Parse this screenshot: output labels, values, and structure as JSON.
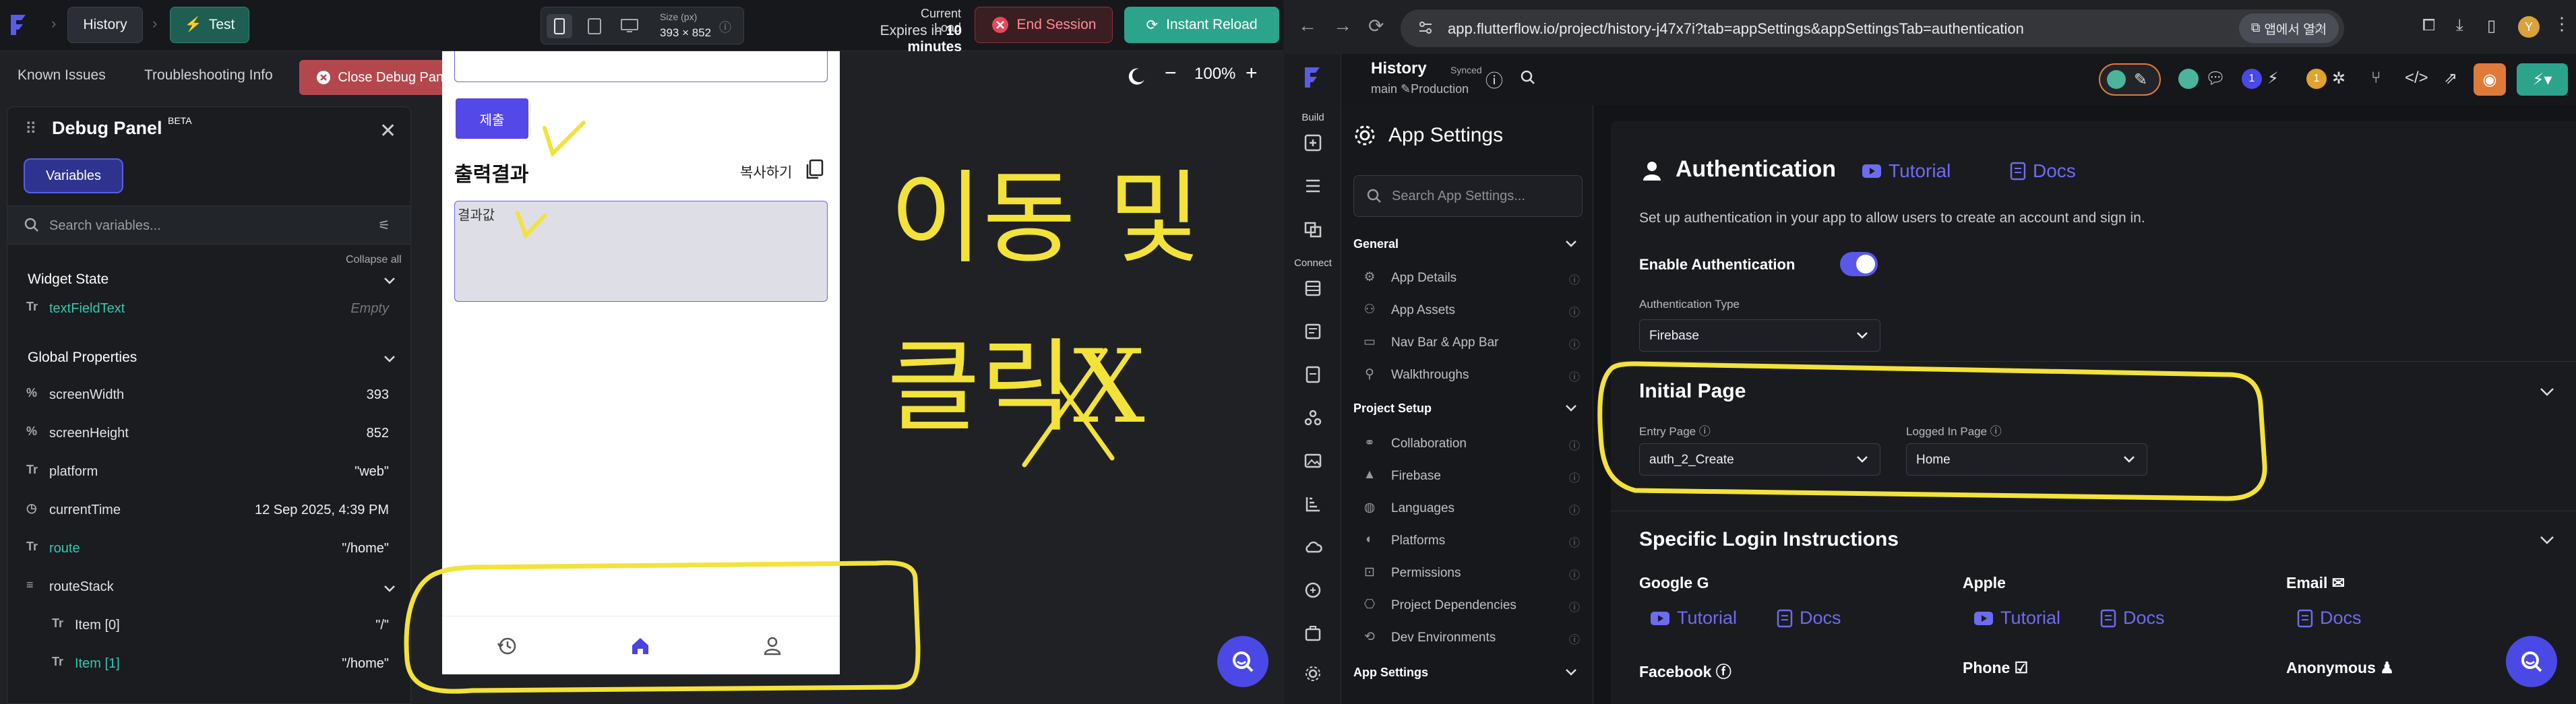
{
  "left": {
    "breadcrumb": {
      "history": "History",
      "test": "Test"
    },
    "device": {
      "size_label": "Size (px)",
      "size_value": "393 × 852"
    },
    "load": {
      "label": "Current Load",
      "expires_prefix": "Expires in",
      "expires_value": "10 minutes"
    },
    "buttons": {
      "end_session": "End Session",
      "instant_reload": "Instant Reload"
    },
    "subbar": {
      "known_issues": "Known Issues",
      "troubleshooting": "Troubleshooting Info",
      "close_debug": "Close Debug Panel"
    },
    "zoom": "100%",
    "debug": {
      "title": "Debug Panel",
      "beta": "BETA",
      "tab_variables": "Variables",
      "search_placeholder": "Search variables...",
      "collapse_all": "Collapse all",
      "widget_state": "Widget State",
      "global_properties": "Global Properties",
      "rows": [
        {
          "icon": "Tr",
          "name": "textFieldText",
          "value": "Empty",
          "teal": true
        },
        {
          "icon": "%",
          "name": "screenWidth",
          "value": "393"
        },
        {
          "icon": "%",
          "name": "screenHeight",
          "value": "852"
        },
        {
          "icon": "Tr",
          "name": "platform",
          "value": "\"web\""
        },
        {
          "icon": "◷",
          "name": "currentTime",
          "value": "12 Sep 2025, 4:39 PM"
        },
        {
          "icon": "Tr",
          "name": "route",
          "value": "\"/home\"",
          "teal": true
        },
        {
          "icon": "≡",
          "name": "routeStack",
          "value": ""
        },
        {
          "icon": "Tr",
          "name": "Item [0]",
          "value": "\"/\""
        },
        {
          "icon": "Tr",
          "name": "Item [1]",
          "value": "\"/home\"",
          "teal": true
        }
      ]
    },
    "phone": {
      "submit": "제출",
      "output_title": "출력결과",
      "copy": "복사하기",
      "result": "결과값"
    },
    "annotation": {
      "line1": "이동 및",
      "line2": "클릭X"
    }
  },
  "right": {
    "url": "app.flutterflow.io/project/history-j47x7i?tab=appSettings&appSettingsTab=authentication",
    "open_app": "앱에서 열기",
    "avatar": "Y",
    "project": {
      "name": "History",
      "synced": "Synced",
      "branch": "main  ✎Production"
    },
    "rail": {
      "build": "Build",
      "connect": "Connect"
    },
    "settings": {
      "title": "App Settings",
      "search_placeholder": "Search App Settings...",
      "groups": [
        {
          "label": "General",
          "items": [
            "App Details",
            "App Assets",
            "Nav Bar & App Bar",
            "Walkthroughs"
          ]
        },
        {
          "label": "Project Setup",
          "items": [
            "Collaboration",
            "Firebase",
            "Languages",
            "Platforms",
            "Permissions",
            "Project Dependencies",
            "Dev Environments"
          ]
        },
        {
          "label": "App Settings",
          "items": []
        }
      ]
    },
    "auth": {
      "title": "Authentication",
      "tutorial": "Tutorial",
      "docs": "Docs",
      "description": "Set up authentication in your app to allow users to create an account and sign in.",
      "enable_label": "Enable Authentication",
      "enabled": true,
      "type_label": "Authentication Type",
      "type_value": "Firebase",
      "initial_page": "Initial Page",
      "entry_page_label": "Entry Page",
      "entry_page_value": "auth_2_Create",
      "logged_in_label": "Logged In Page",
      "logged_in_value": "Home",
      "specific_login": "Specific Login Instructions",
      "providers": [
        {
          "name": "Google",
          "tutorial": "Tutorial",
          "docs": "Docs"
        },
        {
          "name": "Apple",
          "tutorial": "Tutorial",
          "docs": "Docs"
        },
        {
          "name": "Email",
          "docs": "Docs"
        }
      ],
      "providers_row2": [
        "Facebook",
        "Phone",
        "Anonymous"
      ]
    }
  },
  "colors": {
    "accent": "#5448e8",
    "teal": "#2ca48c",
    "annotation": "#f3e23a",
    "danger": "#b4474e"
  }
}
